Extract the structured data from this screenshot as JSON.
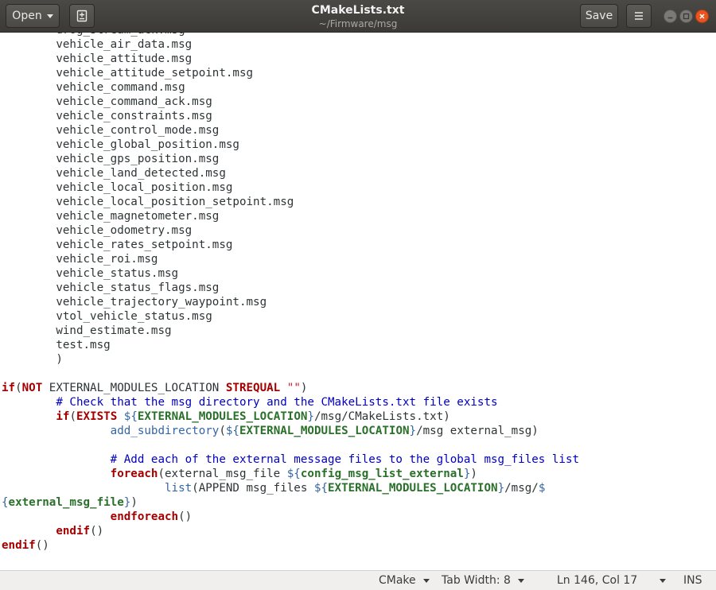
{
  "header": {
    "open_label": "Open",
    "save_label": "Save",
    "title": "CMakeLists.txt",
    "subtitle": "~/Firmware/msg"
  },
  "editor": {
    "lines": [
      [
        {
          "t": "\tdrog_stream_ack.msg"
        }
      ],
      [
        {
          "t": "\tvehicle_air_data.msg"
        }
      ],
      [
        {
          "t": "\tvehicle_attitude.msg"
        }
      ],
      [
        {
          "t": "\tvehicle_attitude_setpoint.msg"
        }
      ],
      [
        {
          "t": "\tvehicle_command.msg"
        }
      ],
      [
        {
          "t": "\tvehicle_command_ack.msg"
        }
      ],
      [
        {
          "t": "\tvehicle_constraints.msg"
        }
      ],
      [
        {
          "t": "\tvehicle_control_mode.msg"
        }
      ],
      [
        {
          "t": "\tvehicle_global_position.msg"
        }
      ],
      [
        {
          "t": "\tvehicle_gps_position.msg"
        }
      ],
      [
        {
          "t": "\tvehicle_land_detected.msg"
        }
      ],
      [
        {
          "t": "\tvehicle_local_position.msg"
        }
      ],
      [
        {
          "t": "\tvehicle_local_position_setpoint.msg"
        }
      ],
      [
        {
          "t": "\tvehicle_magnetometer.msg"
        }
      ],
      [
        {
          "t": "\tvehicle_odometry.msg"
        }
      ],
      [
        {
          "t": "\tvehicle_rates_setpoint.msg"
        }
      ],
      [
        {
          "t": "\tvehicle_roi.msg"
        }
      ],
      [
        {
          "t": "\tvehicle_status.msg"
        }
      ],
      [
        {
          "t": "\tvehicle_status_flags.msg"
        }
      ],
      [
        {
          "t": "\tvehicle_trajectory_waypoint.msg"
        }
      ],
      [
        {
          "t": "\tvtol_vehicle_status.msg"
        }
      ],
      [
        {
          "t": "\twind_estimate.msg"
        }
      ],
      [
        {
          "t": "\ttest.msg"
        }
      ],
      [
        {
          "t": "\t)"
        }
      ],
      [
        {
          "t": ""
        }
      ],
      [
        {
          "t": "if",
          "c": "kw"
        },
        {
          "t": "("
        },
        {
          "t": "NOT",
          "c": "kw"
        },
        {
          "t": " EXTERNAL_MODULES_LOCATION "
        },
        {
          "t": "STREQUAL",
          "c": "kw"
        },
        {
          "t": " "
        },
        {
          "t": "\"\"",
          "c": "str"
        },
        {
          "t": ")"
        }
      ],
      [
        {
          "t": "\t"
        },
        {
          "t": "# Check that the msg directory and the CMakeLists.txt file exists",
          "c": "cmt"
        }
      ],
      [
        {
          "t": "\t"
        },
        {
          "t": "if",
          "c": "kw"
        },
        {
          "t": "("
        },
        {
          "t": "EXISTS",
          "c": "kw"
        },
        {
          "t": " "
        },
        {
          "t": "${",
          "c": "fn"
        },
        {
          "t": "EXTERNAL_MODULES_LOCATION",
          "c": "vr"
        },
        {
          "t": "}",
          "c": "fn"
        },
        {
          "t": "/msg/CMakeLists.txt)"
        }
      ],
      [
        {
          "t": "\t\t"
        },
        {
          "t": "add_subdirectory",
          "c": "fn"
        },
        {
          "t": "("
        },
        {
          "t": "${",
          "c": "fn"
        },
        {
          "t": "EXTERNAL_MODULES_LOCATION",
          "c": "vr"
        },
        {
          "t": "}",
          "c": "fn"
        },
        {
          "t": "/msg external_msg)"
        }
      ],
      [
        {
          "t": ""
        }
      ],
      [
        {
          "t": "\t\t"
        },
        {
          "t": "# Add each of the external message files to the global msg_files list",
          "c": "cmt"
        }
      ],
      [
        {
          "t": "\t\t"
        },
        {
          "t": "foreach",
          "c": "kw"
        },
        {
          "t": "(external_msg_file "
        },
        {
          "t": "${",
          "c": "fn"
        },
        {
          "t": "config_msg_list_external",
          "c": "vr"
        },
        {
          "t": "}",
          "c": "fn"
        },
        {
          "t": ")"
        }
      ],
      [
        {
          "t": "\t\t\t"
        },
        {
          "t": "list",
          "c": "fn"
        },
        {
          "t": "(APPEND msg_files "
        },
        {
          "t": "${",
          "c": "fn"
        },
        {
          "t": "EXTERNAL_MODULES_LOCATION",
          "c": "vr"
        },
        {
          "t": "}",
          "c": "fn"
        },
        {
          "t": "/msg/"
        },
        {
          "t": "$",
          "c": "fn"
        }
      ],
      [
        {
          "t": "{",
          "c": "fn"
        },
        {
          "t": "external_msg_file",
          "c": "vr"
        },
        {
          "t": "}",
          "c": "fn"
        },
        {
          "t": ")"
        }
      ],
      [
        {
          "t": "\t\t"
        },
        {
          "t": "endforeach",
          "c": "kw"
        },
        {
          "t": "()"
        }
      ],
      [
        {
          "t": "\t"
        },
        {
          "t": "endif",
          "c": "kw"
        },
        {
          "t": "()"
        }
      ],
      [
        {
          "t": "endif",
          "c": "kw"
        },
        {
          "t": "()"
        }
      ]
    ]
  },
  "statusbar": {
    "language": "CMake",
    "tab_width": "Tab Width: 8",
    "position": "Ln 146, Col 17",
    "mode": "INS"
  }
}
